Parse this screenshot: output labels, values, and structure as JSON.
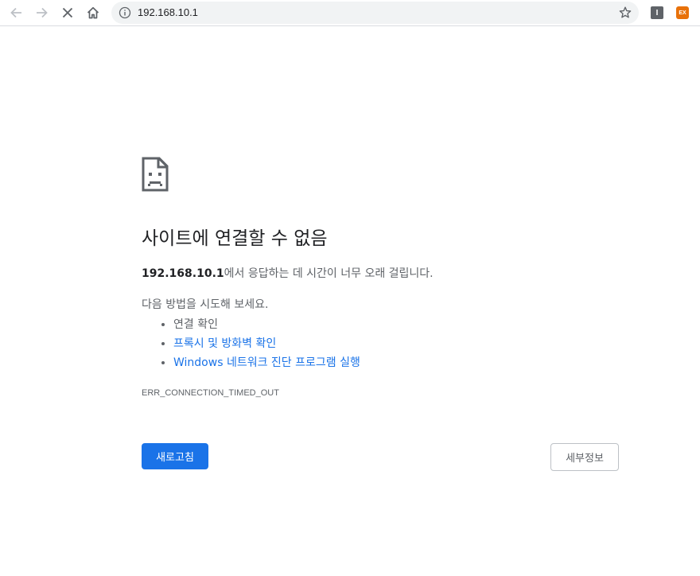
{
  "toolbar": {
    "url": "192.168.10.1",
    "ext1_label": "I",
    "ext2_label": "EX"
  },
  "error": {
    "heading": "사이트에 연결할 수 없음",
    "host": "192.168.10.1",
    "desc_suffix": "에서 응답하는 데 시간이 너무 오래 걸립니다.",
    "suggest_heading": "다음 방법을 시도해 보세요.",
    "suggestions": [
      "연결 확인",
      "프록시 및 방화벽 확인",
      "Windows 네트워크 진단 프로그램 실행"
    ],
    "code": "ERR_CONNECTION_TIMED_OUT",
    "reload_label": "새로고침",
    "details_label": "세부정보"
  },
  "colors": {
    "accent": "#1a73e8",
    "text_primary": "#202124",
    "text_secondary": "#5f6368",
    "omnibox_bg": "#f1f3f4"
  }
}
